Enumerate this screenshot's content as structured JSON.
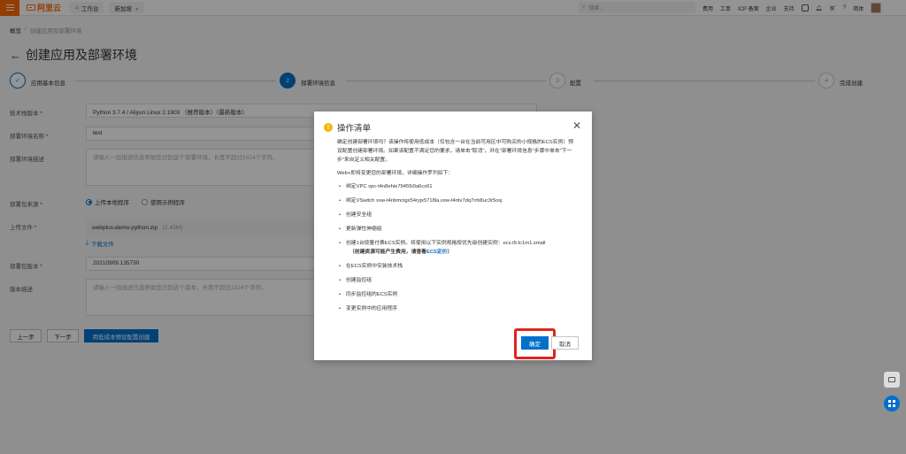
{
  "topbar": {
    "logo_text": "阿里云",
    "workbench": "工作台",
    "region": "新加坡",
    "search_placeholder": "搜索...",
    "links": [
      "费用",
      "工单",
      "ICP 备案",
      "企业",
      "支持"
    ],
    "language": "简体"
  },
  "breadcrumb": [
    "概览",
    "/",
    "创建应用及部署环境"
  ],
  "page_title": "创建应用及部署环境",
  "steps": [
    {
      "label": "应用基本信息",
      "number": "",
      "state": "done"
    },
    {
      "label": "部署环境信息",
      "number": "2",
      "state": "active"
    },
    {
      "label": "配置",
      "number": "3",
      "state": "wait"
    },
    {
      "label": "完成创建",
      "number": "4",
      "state": "wait"
    }
  ],
  "form": {
    "tech_stack_label": "技术栈版本 *",
    "tech_stack_value": "Python 3.7.4 / Aliyun Linux 2.1903 （推荐版本）（最新版本）",
    "env_name_label": "部署环境名称 *",
    "env_name_value": "test",
    "env_desc_label": "部署环境描述",
    "env_desc_placeholder": "请输入一段描述信息帮助您识别这个部署环境，长度不超过1024个字符。",
    "package_source_label": "部署包来源 *",
    "radio_upload": "上传本地程序",
    "radio_sample": "使用示例程序",
    "upload_label": "上传文件 *",
    "file_name": "webplus-demo-python.zip",
    "file_size": "(2.43M)",
    "download_link": "下载文件",
    "version_label": "部署包版本 *",
    "version_value": "20210909.135730",
    "version_desc_label": "版本描述",
    "version_desc_placeholder": "请输入一段描述信息帮助您识别这个版本，长度不超过1024个字符。"
  },
  "buttons": {
    "prev": "上一步",
    "next": "下一步",
    "create_low_cost": "用低成本预设配置创建"
  },
  "modal": {
    "title": "操作清单",
    "intro": "确定创建部署环境吗？该操作将使用低成本（仅包含一台在当前可用区中可购买的小规格的ECS实例）预设配置创建部署环境。如果该配置不满足您的要求，请单击\"取消\"，并在\"部署环境信息\"步骤中单击\"下一步\"来自定义相关配置。",
    "ops_title": "Web+即将变更您的部署环境，详细操作罗列如下：",
    "ops": [
      "绑定VPC vpc-t4n8ehie79455i0a6cs61",
      "绑定VSwitch vsw-t4nbmcigx54ryjx5718la,vsw-t4ntv7dq7rrb8uc3r5osj",
      "创建安全组",
      "更新弹性伸缩组",
      "创建1台按量付费ECS实例。将使用以下实例规格按优先级创建实例：ecs.t5-lc1m1.small",
      "在ECS实例中安装技术栈",
      "创建监控组",
      "同步监控组的ECS实例",
      "变更实例中的应用程序"
    ],
    "note_prefix": "（创建资源可能产生费用，请查看",
    "note_link": "ECS定价",
    "note_suffix": "）",
    "confirm": "确定",
    "cancel": "取消"
  },
  "colors": {
    "brand_orange": "#ff6a00",
    "primary_blue": "#0070cc",
    "highlight_red": "#e0251b",
    "warning_yellow": "#f7b500"
  }
}
